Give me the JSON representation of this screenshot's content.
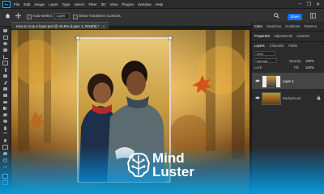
{
  "menubar": {
    "logo": "Ps",
    "items": [
      "File",
      "Edit",
      "Image",
      "Layer",
      "Type",
      "Select",
      "Filter",
      "3D",
      "View",
      "Plugins",
      "Window",
      "Help"
    ],
    "window_controls": [
      "–",
      "❐",
      "✕"
    ]
  },
  "options_bar": {
    "home_icon": "home-icon",
    "tool_icon": "move-tool-icon",
    "auto_select_label": "Auto-Select:",
    "auto_select_value": "Layer",
    "transform_label": "Show Transform Controls",
    "share_label": "Share"
  },
  "document": {
    "tab_title": "How to crop a layer.psd @ 45.8% (Layer 1, RGB/8) *",
    "close_glyph": "×"
  },
  "panels": {
    "top_tabs": [
      "Color",
      "Swatches",
      "Gradients",
      "Patterns"
    ],
    "props_tabs": [
      "Properties",
      "Adjustments",
      "Libraries"
    ],
    "layers_tabs": [
      "Layers",
      "Channels",
      "Paths"
    ],
    "search_placeholder": "Kind",
    "blend_mode": "Normal",
    "opacity_label": "Opacity:",
    "opacity_value": "100%",
    "lock_label": "Lock:",
    "fill_label": "Fill:",
    "fill_value": "100%",
    "layers": [
      {
        "name": "Layer 1",
        "visible": true,
        "selected": true
      },
      {
        "name": "Background",
        "visible": true,
        "selected": false,
        "locked": true
      }
    ]
  },
  "watermark": {
    "line1": "Mind",
    "line2": "Luster",
    "logo_icon": "brain-logo-icon"
  },
  "colors": {
    "accent": "#1473e6",
    "panel_bg": "#2b2b2b",
    "brand_glow": "#00aff5"
  }
}
